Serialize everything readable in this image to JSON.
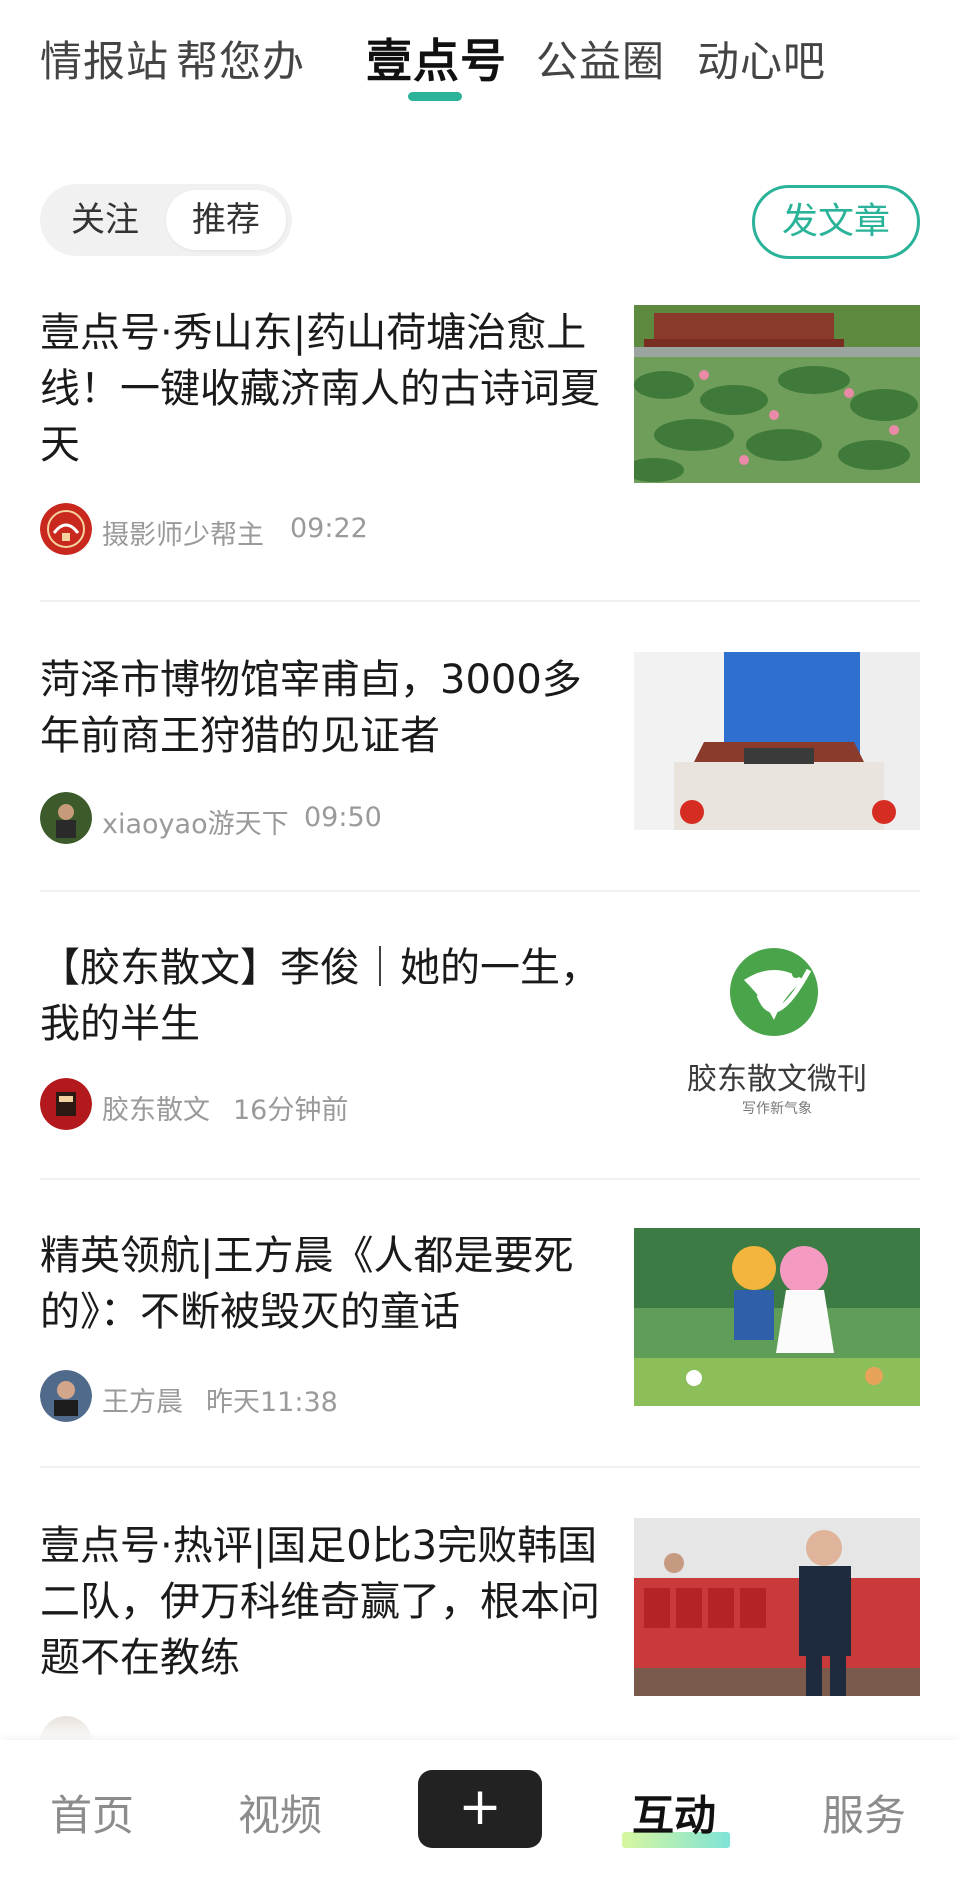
{
  "top_tabs": [
    "情报站",
    "帮您办",
    "壹点号",
    "公益圈",
    "动心吧"
  ],
  "active_tab_index": 2,
  "filter": {
    "follow": "关注",
    "recommend": "推荐",
    "active": "推荐",
    "write_button": "发文章"
  },
  "articles": [
    {
      "title": "壹点号·秀山东|药山荷塘治愈上线！一键收藏济南人的古诗词夏天",
      "author": "摄影师少帮主",
      "time": "09:22",
      "thumbnail": "lotus-pond-pavilion-photo"
    },
    {
      "title": "菏泽市博物馆宰甫卣，3000多年前商王狩猎的见证者",
      "author": "xiaoyao游天下",
      "time": "09:50",
      "thumbnail": "museum-building-photo"
    },
    {
      "title": "【胶东散文】李俊｜她的一生，我的半生",
      "author": "胶东散文",
      "time": "16分钟前",
      "thumbnail": "jiaodong-prose-logo",
      "thumb_logo_text": "胶东散文微刊",
      "thumb_logo_sub": "写作新气象"
    },
    {
      "title": "精英领航|王方晨《人都是要死的》：不断被毁灭的童话",
      "author": "王方晨",
      "time": "昨天11:38",
      "thumbnail": "cartoon-children-forest-illustration"
    },
    {
      "title": "壹点号·热评|国足0比3完败韩国二队，伊万科维奇赢了，根本问题不在教练",
      "author": "",
      "time": "",
      "thumbnail": "football-coach-photo"
    }
  ],
  "bottom_nav": {
    "home": "首页",
    "video": "视频",
    "plus": "+",
    "interact": "互动",
    "service": "服务",
    "active": "互动"
  },
  "colors": {
    "accent": "#2bb39a",
    "text_primary": "#1a1a1a",
    "text_secondary": "#9a9a9a",
    "plus_button_bg": "#222222"
  }
}
